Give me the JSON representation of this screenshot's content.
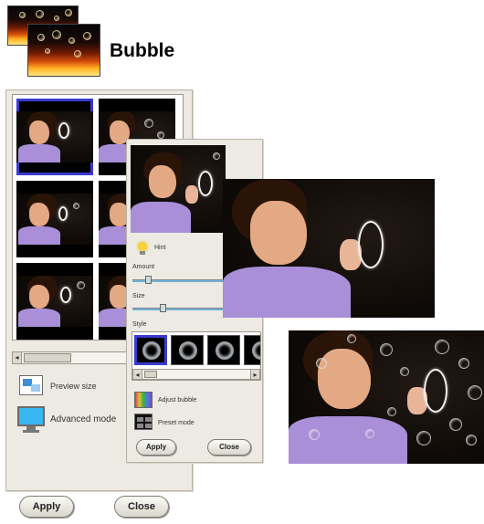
{
  "header": {
    "title": "Bubble"
  },
  "dialog_small": {
    "apply_label": "Apply",
    "close_label": "Close",
    "preview_size_label": "Preview size",
    "advanced_mode_label": "Advanced mode"
  },
  "dialog_advanced": {
    "hint_label": "Hint",
    "amount_label": "Amount",
    "size_label": "Size",
    "style_label": "Style",
    "adjust_bubble_label": "Adjust bubble",
    "preset_mode_label": "Preset mode",
    "apply_label": "Apply",
    "close_label": "Close"
  },
  "colors": {
    "dialog_bg": "#eceae2",
    "selection": "#3a3ad0",
    "shirt": "#a88fd8",
    "slider": "#6fb0d8"
  },
  "icons": [
    "effect-thumbnail-icon",
    "lightbulb-icon",
    "preview-size-icon",
    "monitor-icon",
    "adjust-bubble-icon",
    "preset-mode-icon"
  ]
}
